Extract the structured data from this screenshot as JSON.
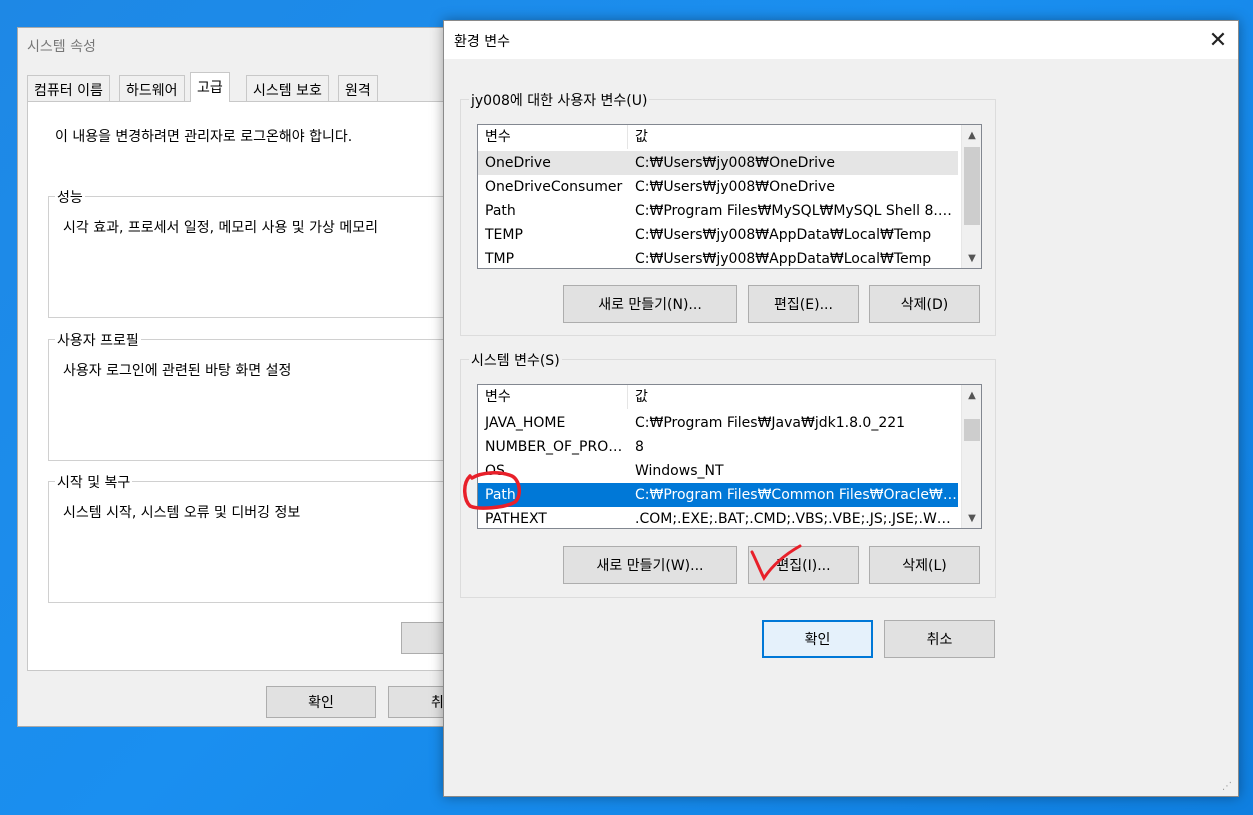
{
  "system_properties": {
    "title": "시스템 속성",
    "tabs": [
      {
        "label": "컴퓨터 이름"
      },
      {
        "label": "하드웨어"
      },
      {
        "label": "고급"
      },
      {
        "label": "시스템 보호"
      },
      {
        "label": "원격"
      }
    ],
    "active_tab": "고급",
    "admin_note": "이 내용을 변경하려면 관리자로 로그온해야 합니다.",
    "groups": [
      {
        "label": "성능",
        "text": "시각 효과, 프로세서 일정, 메모리 사용 및 가상 메모리"
      },
      {
        "label": "사용자 프로필",
        "text": "사용자 로그인에 관련된 바탕 화면 설정"
      },
      {
        "label": "시작 및 복구",
        "text": "시스템 시작, 시스템 오류 및 디버깅 정보"
      }
    ],
    "ok_label": "확인",
    "cancel_label": "취"
  },
  "env_dialog": {
    "title": "환경 변수",
    "close_icon": "close-icon",
    "user_section": {
      "label": "jy008에 대한 사용자 변수(U)",
      "col_name": "변수",
      "col_value": "값",
      "rows": [
        {
          "name": "OneDrive",
          "value": "C:₩Users₩jy008₩OneDrive"
        },
        {
          "name": "OneDriveConsumer",
          "value": "C:₩Users₩jy008₩OneDrive"
        },
        {
          "name": "Path",
          "value": "C:₩Program Files₩MySQL₩MySQL Shell 8.0₩..."
        },
        {
          "name": "TEMP",
          "value": "C:₩Users₩jy008₩AppData₩Local₩Temp"
        },
        {
          "name": "TMP",
          "value": "C:₩Users₩jy008₩AppData₩Local₩Temp"
        }
      ],
      "new_label": "새로 만들기(N)...",
      "edit_label": "편집(E)...",
      "delete_label": "삭제(D)"
    },
    "system_section": {
      "label": "시스템 변수(S)",
      "col_name": "변수",
      "col_value": "값",
      "rows": [
        {
          "name": "JAVA_HOME",
          "value": "C:₩Program Files₩Java₩jdk1.8.0_221"
        },
        {
          "name": "NUMBER_OF_PROC...",
          "value": "8"
        },
        {
          "name": "OS",
          "value": "Windows_NT"
        },
        {
          "name": "Path",
          "value": "C:₩Program Files₩Common Files₩Oracle₩Ja..."
        },
        {
          "name": "PATHEXT",
          "value": ".COM;.EXE;.BAT;.CMD;.VBS;.VBE;.JS;.JSE;.WSF;..."
        }
      ],
      "selected_row": "Path",
      "new_label": "새로 만들기(W)...",
      "edit_label": "편집(I)...",
      "delete_label": "삭제(L)"
    },
    "ok_label": "확인",
    "cancel_label": "취소",
    "annotation_color": "#e8202a",
    "accent_color": "#0078d7"
  }
}
